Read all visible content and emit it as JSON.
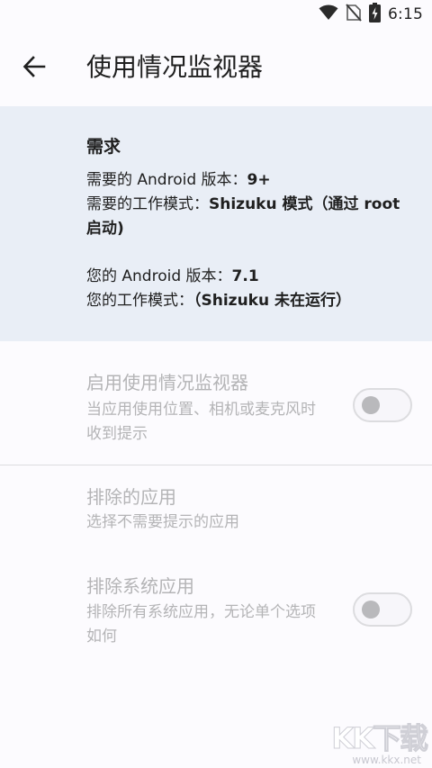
{
  "status_bar": {
    "time": "6:15",
    "icons": [
      "wifi-icon",
      "no-sim-icon",
      "battery-charging-icon"
    ]
  },
  "app_bar": {
    "back_icon": "arrow-left-icon",
    "title": "使用情况监视器"
  },
  "requirements": {
    "heading": "需求",
    "required_android_label": "需要的 Android 版本：",
    "required_android_value": "9+",
    "required_mode_label": "需要的工作模式：",
    "required_mode_value": "Shizuku 模式（通过 root 启动)",
    "your_android_label": "您的 Android 版本：",
    "your_android_value": "7.1",
    "your_mode_label": "您的工作模式：",
    "your_mode_value": "（Shizuku 未在运行）"
  },
  "settings": {
    "enable_monitor": {
      "title": "启用使用情况监视器",
      "summary": "当应用使用位置、相机或麦克风时收到提示",
      "enabled": false
    },
    "excluded_apps": {
      "title": "排除的应用",
      "summary": "选择不需要提示的应用"
    },
    "exclude_system_apps": {
      "title": "排除系统应用",
      "summary": "排除所有系统应用，无论单个选项如何",
      "enabled": false
    }
  },
  "watermark": {
    "logo": "KK下载",
    "url": "www.kkx.net"
  }
}
